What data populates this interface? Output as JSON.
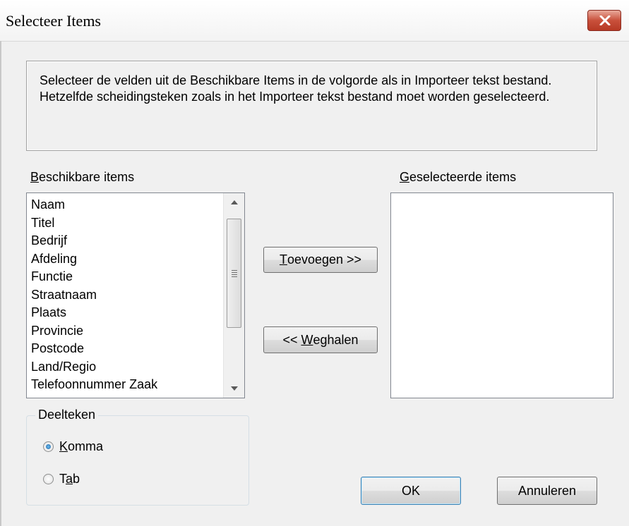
{
  "window": {
    "title": "Selecteer Items"
  },
  "info": {
    "line1": "Selecteer de velden uit de Beschikbare Items in de volgorde als in Importeer tekst bestand.",
    "line2": "Hetzelfde scheidingsteken zoals in het Importeer tekst bestand moet worden geselecteerd."
  },
  "available": {
    "label_mnemonic": "B",
    "label_rest": "eschikbare items",
    "items": [
      "Naam",
      "Titel",
      "Bedrijf",
      "Afdeling",
      "Functie",
      "Straatnaam",
      "Plaats",
      "Provincie",
      "Postcode",
      "Land/Regio",
      "Telefoonnummer Zaak"
    ]
  },
  "selected": {
    "label_mnemonic": "G",
    "label_rest": "eselecteerde items",
    "items": []
  },
  "buttons": {
    "add_mnemonic": "T",
    "add_rest": "oevoegen >>",
    "remove_prefix": "<< ",
    "remove_mnemonic": "W",
    "remove_rest": "eghalen",
    "ok": "OK",
    "cancel": "Annuleren"
  },
  "delimiter": {
    "legend": "Deelteken",
    "option1_mnemonic": "K",
    "option1_rest": "omma",
    "option2_prefix": "T",
    "option2_mnemonic": "a",
    "option2_rest": "b",
    "selected": "Komma"
  },
  "icons": {
    "close": "close-icon",
    "scroll_up": "scroll-up-arrow-icon",
    "scroll_down": "scroll-down-arrow-icon"
  },
  "colors": {
    "close_button": "#c9503b",
    "radio_selected": "#1b5fa4"
  }
}
